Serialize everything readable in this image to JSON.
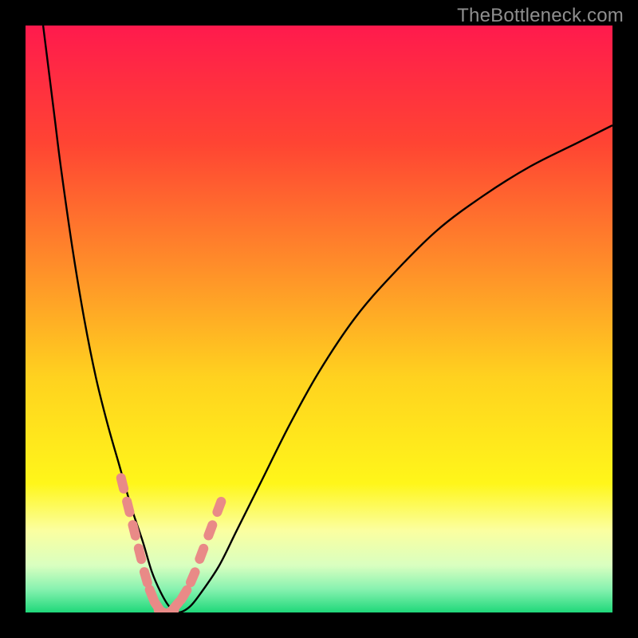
{
  "watermark": "TheBottleneck.com",
  "chart_data": {
    "type": "line",
    "title": "",
    "xlabel": "",
    "ylabel": "",
    "xlim": [
      0,
      100
    ],
    "ylim": [
      0,
      100
    ],
    "background_gradient": {
      "stops": [
        {
          "pos": 0.0,
          "color": "#ff1a4d"
        },
        {
          "pos": 0.2,
          "color": "#ff4433"
        },
        {
          "pos": 0.4,
          "color": "#ff8a2a"
        },
        {
          "pos": 0.6,
          "color": "#ffd21f"
        },
        {
          "pos": 0.78,
          "color": "#fff61a"
        },
        {
          "pos": 0.86,
          "color": "#fbffa0"
        },
        {
          "pos": 0.92,
          "color": "#d9ffc0"
        },
        {
          "pos": 0.96,
          "color": "#88f2b0"
        },
        {
          "pos": 1.0,
          "color": "#1fd87a"
        }
      ]
    },
    "series": [
      {
        "name": "bottleneck-curve",
        "color": "#000000",
        "x": [
          3,
          4,
          5,
          6,
          8,
          10,
          12,
          14,
          16,
          18,
          20,
          21.5,
          23,
          24.5,
          26,
          28,
          30,
          33,
          36,
          40,
          45,
          50,
          56,
          62,
          70,
          78,
          86,
          94,
          100
        ],
        "y": [
          100,
          92,
          84,
          76,
          62,
          50,
          40,
          32,
          25,
          18,
          12,
          7,
          3.5,
          1,
          0,
          1,
          3.5,
          8,
          14,
          22,
          32,
          41,
          50,
          57,
          65,
          71,
          76,
          80,
          83
        ]
      },
      {
        "name": "highlight-markers",
        "color": "#e98a87",
        "marker": "rounded-pill",
        "x": [
          16.5,
          17.5,
          18.5,
          19.5,
          20.5,
          21.5,
          22.5,
          23.5,
          24.5,
          25.5,
          27.0,
          28.5,
          30.0,
          31.5,
          33.0
        ],
        "y": [
          22,
          18,
          14,
          10,
          6,
          3,
          1,
          0,
          0,
          1,
          3,
          6,
          10,
          14,
          18
        ]
      }
    ]
  }
}
